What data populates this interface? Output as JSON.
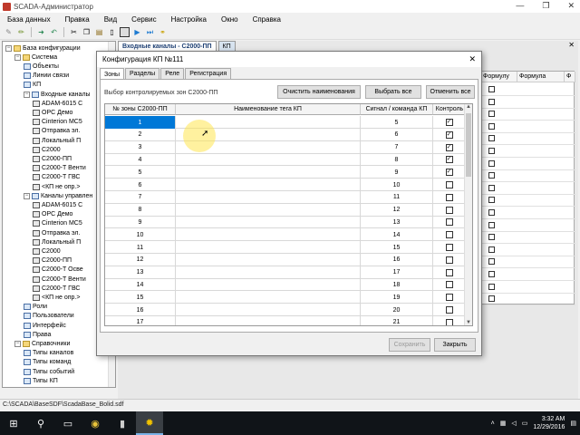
{
  "window": {
    "title": "SCADA-Администратор",
    "controls": [
      "—",
      "❐",
      "✕"
    ]
  },
  "menu": [
    "База данных",
    "Правка",
    "Вид",
    "Сервис",
    "Настройка",
    "Окно",
    "Справка"
  ],
  "toolbar_icons": [
    "wand-icon",
    "pencil-icon",
    "forward-icon",
    "back-icon",
    "cut-icon",
    "copy-icon",
    "paste-icon",
    "delete-icon",
    "window-icon",
    "play-icon",
    "step-icon",
    "link-icon"
  ],
  "tree": {
    "items": [
      {
        "label": "База конфигурации",
        "level": 0,
        "exp": "−",
        "icon": "folder"
      },
      {
        "label": "Система",
        "level": 1,
        "exp": "−",
        "icon": "folder"
      },
      {
        "label": "Объекты",
        "level": 2,
        "exp": "",
        "icon": "page"
      },
      {
        "label": "Линии связи",
        "level": 2,
        "exp": "",
        "icon": "page"
      },
      {
        "label": "КП",
        "level": 2,
        "exp": "",
        "icon": "page"
      },
      {
        "label": "Входные каналы",
        "level": 2,
        "exp": "−",
        "icon": "page"
      },
      {
        "label": "ADAM-6015 C",
        "level": 3,
        "exp": "",
        "icon": "dev"
      },
      {
        "label": "OPC Демо",
        "level": 3,
        "exp": "",
        "icon": "dev"
      },
      {
        "label": "Cinterion MC5",
        "level": 3,
        "exp": "",
        "icon": "dev"
      },
      {
        "label": "Отправка эл.",
        "level": 3,
        "exp": "",
        "icon": "dev"
      },
      {
        "label": "Локальный П",
        "level": 3,
        "exp": "",
        "icon": "dev"
      },
      {
        "label": "С2000",
        "level": 3,
        "exp": "",
        "icon": "dev"
      },
      {
        "label": "С2000-ПП",
        "level": 3,
        "exp": "",
        "icon": "dev"
      },
      {
        "label": "С2000-Т Венти",
        "level": 3,
        "exp": "",
        "icon": "dev"
      },
      {
        "label": "С2000-Т ГВС",
        "level": 3,
        "exp": "",
        "icon": "dev"
      },
      {
        "label": "<КП не опр.>",
        "level": 3,
        "exp": "",
        "icon": "dev"
      },
      {
        "label": "Каналы управлен",
        "level": 2,
        "exp": "−",
        "icon": "page"
      },
      {
        "label": "ADAM-6015 C",
        "level": 3,
        "exp": "",
        "icon": "dev"
      },
      {
        "label": "OPC Демо",
        "level": 3,
        "exp": "",
        "icon": "dev"
      },
      {
        "label": "Cinterion MC5",
        "level": 3,
        "exp": "",
        "icon": "dev"
      },
      {
        "label": "Отправка эл.",
        "level": 3,
        "exp": "",
        "icon": "dev"
      },
      {
        "label": "Локальный П",
        "level": 3,
        "exp": "",
        "icon": "dev"
      },
      {
        "label": "С2000",
        "level": 3,
        "exp": "",
        "icon": "dev"
      },
      {
        "label": "С2000-ПП",
        "level": 3,
        "exp": "",
        "icon": "dev"
      },
      {
        "label": "С2000-Т Осве",
        "level": 3,
        "exp": "",
        "icon": "dev"
      },
      {
        "label": "С2000-Т Венти",
        "level": 3,
        "exp": "",
        "icon": "dev"
      },
      {
        "label": "С2000-Т ГВС",
        "level": 3,
        "exp": "",
        "icon": "dev"
      },
      {
        "label": "<КП не опр.>",
        "level": 3,
        "exp": "",
        "icon": "dev"
      },
      {
        "label": "Роли",
        "level": 2,
        "exp": "",
        "icon": "page"
      },
      {
        "label": "Пользователи",
        "level": 2,
        "exp": "",
        "icon": "page"
      },
      {
        "label": "Интерфейс",
        "level": 2,
        "exp": "",
        "icon": "page"
      },
      {
        "label": "Права",
        "level": 2,
        "exp": "",
        "icon": "page"
      },
      {
        "label": "Справочники",
        "level": 1,
        "exp": "−",
        "icon": "folder"
      },
      {
        "label": "Типы каналов",
        "level": 2,
        "exp": "",
        "icon": "page"
      },
      {
        "label": "Типы команд",
        "level": 2,
        "exp": "",
        "icon": "page"
      },
      {
        "label": "Типы событий",
        "level": 2,
        "exp": "",
        "icon": "page"
      },
      {
        "label": "Типы КП",
        "level": 2,
        "exp": "",
        "icon": "page"
      }
    ]
  },
  "doc_tabs": [
    {
      "label": "Входные каналы - С2000-ПП",
      "active": true
    },
    {
      "label": "КП",
      "active": false
    }
  ],
  "background_grid": {
    "headers": [
      "Формулу",
      "Формула",
      "Ф"
    ],
    "row_count": 18
  },
  "dialog": {
    "title": "Конфигурация КП №111",
    "close": "✕",
    "tabs": [
      {
        "label": "Зоны",
        "active": true
      },
      {
        "label": "Разделы",
        "active": false
      },
      {
        "label": "Реле",
        "active": false
      },
      {
        "label": "Регистрация",
        "active": false
      }
    ],
    "zones_label": "Выбор контролируемых зон С2000-ПП",
    "btn_clear_names": "Очистить наименования",
    "btn_select_all": "Выбрать все",
    "btn_deselect_all": "Отменить все",
    "btn_save": "Сохранить",
    "btn_close": "Закрыть",
    "grid": {
      "headers": [
        "№ зоны С2000-ПП",
        "Наименование тега КП",
        "Сигнал / команда КП",
        "Контроль"
      ],
      "rows": [
        {
          "zone": "1",
          "name": "",
          "signal": "5",
          "control": true
        },
        {
          "zone": "2",
          "name": "",
          "signal": "6",
          "control": true
        },
        {
          "zone": "3",
          "name": "",
          "signal": "7",
          "control": true
        },
        {
          "zone": "4",
          "name": "",
          "signal": "8",
          "control": true
        },
        {
          "zone": "5",
          "name": "",
          "signal": "9",
          "control": true
        },
        {
          "zone": "6",
          "name": "",
          "signal": "10",
          "control": false
        },
        {
          "zone": "7",
          "name": "",
          "signal": "11",
          "control": false
        },
        {
          "zone": "8",
          "name": "",
          "signal": "12",
          "control": false
        },
        {
          "zone": "9",
          "name": "",
          "signal": "13",
          "control": false
        },
        {
          "zone": "10",
          "name": "",
          "signal": "14",
          "control": false
        },
        {
          "zone": "11",
          "name": "",
          "signal": "15",
          "control": false
        },
        {
          "zone": "12",
          "name": "",
          "signal": "16",
          "control": false
        },
        {
          "zone": "13",
          "name": "",
          "signal": "17",
          "control": false
        },
        {
          "zone": "14",
          "name": "",
          "signal": "18",
          "control": false
        },
        {
          "zone": "15",
          "name": "",
          "signal": "19",
          "control": false
        },
        {
          "zone": "16",
          "name": "",
          "signal": "20",
          "control": false
        },
        {
          "zone": "17",
          "name": "",
          "signal": "21",
          "control": false
        }
      ],
      "selected_row": 0
    }
  },
  "statusbar": {
    "path": "C:\\SCADA\\BaseSDF\\ScadaBase_Bolid.sdf"
  },
  "taskbar": {
    "items": [
      "windows-icon",
      "search-icon",
      "task-view-icon",
      "chrome-icon",
      "app-icon",
      "scada-icon"
    ],
    "time": "3:32 AM",
    "date": "12/29/2016"
  },
  "colors": {
    "selection": "#0078d7",
    "dialog_bg": "#f0f0f0",
    "taskbar": "#101418"
  }
}
